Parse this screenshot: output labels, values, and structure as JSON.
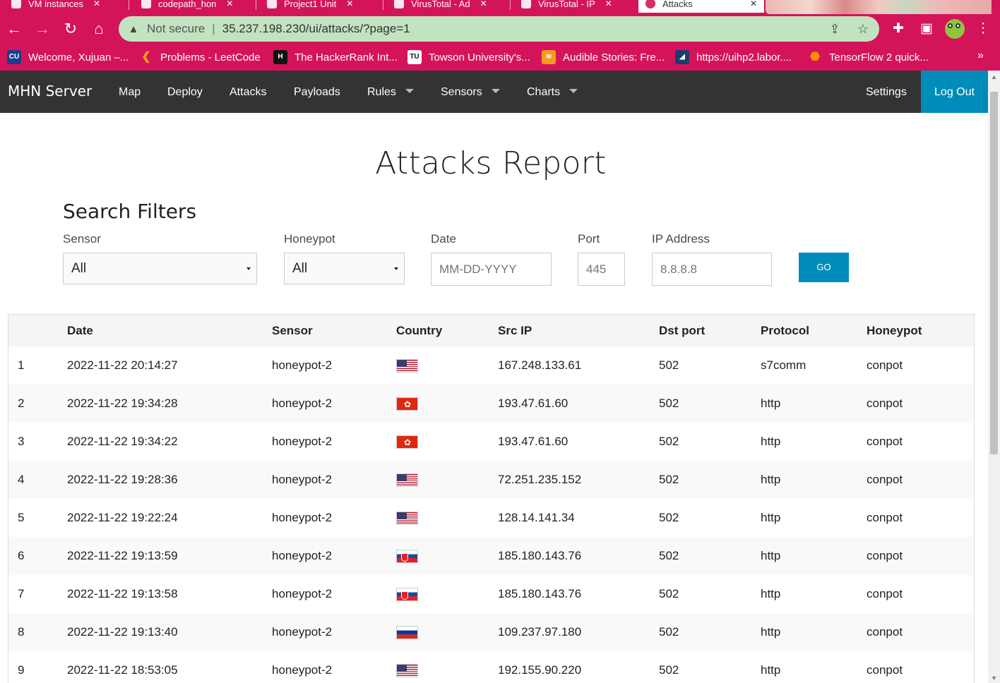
{
  "browser": {
    "tabs": [
      {
        "title": "VM instances"
      },
      {
        "title": "codepath_hon"
      },
      {
        "title": "Project1 Unit"
      },
      {
        "title": "VirusTotal - Ad"
      },
      {
        "title": "VirusTotal - IP"
      },
      {
        "title": "Attacks",
        "active": true
      }
    ],
    "security_label": "Not secure",
    "url": "35.237.198.230/ui/attacks/?page=1",
    "bookmarks": [
      {
        "label": "Welcome, Xujuan –...",
        "icon": "cuny-icon",
        "color": "#1a3e8c"
      },
      {
        "label": "Problems - LeetCode",
        "icon": "leetcode-icon",
        "color": "#f89f1b"
      },
      {
        "label": "The HackerRank Int...",
        "icon": "hackerrank-icon",
        "color": "#111111"
      },
      {
        "label": "Towson University's...",
        "icon": "towson-icon",
        "color": "#ffffff"
      },
      {
        "label": "Audible Stories: Fre...",
        "icon": "audible-icon",
        "color": "#f8991c"
      },
      {
        "label": "https://uihp2.labor....",
        "icon": "ny-state-icon",
        "color": "#1b3d6d"
      },
      {
        "label": "TensorFlow 2 quick...",
        "icon": "tensorflow-icon",
        "color": "#ff8f00"
      }
    ]
  },
  "app": {
    "brand": "MHN Server",
    "nav": [
      {
        "label": "Map"
      },
      {
        "label": "Deploy"
      },
      {
        "label": "Attacks"
      },
      {
        "label": "Payloads"
      },
      {
        "label": "Rules",
        "dropdown": true
      },
      {
        "label": "Sensors",
        "dropdown": true
      },
      {
        "label": "Charts",
        "dropdown": true
      }
    ],
    "settings_label": "Settings",
    "logout_label": "Log Out",
    "accent_color": "#008cba"
  },
  "page": {
    "title": "Attacks Report",
    "filters": {
      "heading": "Search Filters",
      "sensor": {
        "label": "Sensor",
        "value": "All"
      },
      "honeypot": {
        "label": "Honeypot",
        "value": "All"
      },
      "date": {
        "label": "Date",
        "placeholder": "MM-DD-YYYY"
      },
      "port": {
        "label": "Port",
        "placeholder": "445"
      },
      "ip": {
        "label": "IP Address",
        "placeholder": "8.8.8.8"
      },
      "go_label": "GO"
    },
    "table": {
      "columns": [
        "",
        "Date",
        "Sensor",
        "Country",
        "Src IP",
        "Dst port",
        "Protocol",
        "Honeypot"
      ],
      "rows": [
        {
          "n": "1",
          "date": "2022-11-22 20:14:27",
          "sensor": "honeypot-2",
          "country": "us-flag",
          "ip": "167.248.133.61",
          "port": "502",
          "protocol": "s7comm",
          "honeypot": "conpot"
        },
        {
          "n": "2",
          "date": "2022-11-22 19:34:28",
          "sensor": "honeypot-2",
          "country": "hk-flag",
          "ip": "193.47.61.60",
          "port": "502",
          "protocol": "http",
          "honeypot": "conpot"
        },
        {
          "n": "3",
          "date": "2022-11-22 19:34:22",
          "sensor": "honeypot-2",
          "country": "hk-flag",
          "ip": "193.47.61.60",
          "port": "502",
          "protocol": "http",
          "honeypot": "conpot"
        },
        {
          "n": "4",
          "date": "2022-11-22 19:28:36",
          "sensor": "honeypot-2",
          "country": "us-flag",
          "ip": "72.251.235.152",
          "port": "502",
          "protocol": "http",
          "honeypot": "conpot"
        },
        {
          "n": "5",
          "date": "2022-11-22 19:22:24",
          "sensor": "honeypot-2",
          "country": "us-flag",
          "ip": "128.14.141.34",
          "port": "502",
          "protocol": "http",
          "honeypot": "conpot"
        },
        {
          "n": "6",
          "date": "2022-11-22 19:13:59",
          "sensor": "honeypot-2",
          "country": "sk-flag",
          "ip": "185.180.143.76",
          "port": "502",
          "protocol": "http",
          "honeypot": "conpot"
        },
        {
          "n": "7",
          "date": "2022-11-22 19:13:58",
          "sensor": "honeypot-2",
          "country": "sk-flag",
          "ip": "185.180.143.76",
          "port": "502",
          "protocol": "http",
          "honeypot": "conpot"
        },
        {
          "n": "8",
          "date": "2022-11-22 19:13:40",
          "sensor": "honeypot-2",
          "country": "ru-flag",
          "ip": "109.237.97.180",
          "port": "502",
          "protocol": "http",
          "honeypot": "conpot"
        },
        {
          "n": "9",
          "date": "2022-11-22 18:53:05",
          "sensor": "honeypot-2",
          "country": "us-flag",
          "ip": "192.155.90.220",
          "port": "502",
          "protocol": "http",
          "honeypot": "conpot"
        }
      ]
    }
  }
}
